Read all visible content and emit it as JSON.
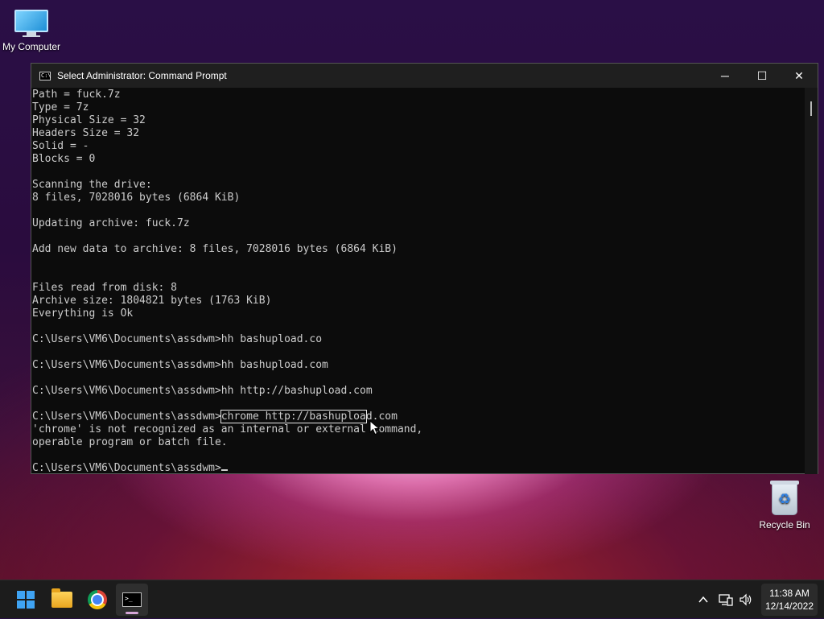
{
  "desktop": {
    "my_computer_label": "My Computer",
    "recycle_bin_label": "Recycle Bin"
  },
  "window": {
    "title": "Select Administrator: Command Prompt",
    "minimize_glyph": "─",
    "maximize_glyph": "☐",
    "close_glyph": "✕"
  },
  "console": {
    "lines": [
      "Path = fuck.7z",
      "Type = 7z",
      "Physical Size = 32",
      "Headers Size = 32",
      "Solid = -",
      "Blocks = 0",
      "",
      "Scanning the drive:",
      "8 files, 7028016 bytes (6864 KiB)",
      "",
      "Updating archive: fuck.7z",
      "",
      "Add new data to archive: 8 files, 7028016 bytes (6864 KiB)",
      "",
      "",
      "Files read from disk: 8",
      "Archive size: 1804821 bytes (1763 KiB)",
      "Everything is Ok",
      "",
      "C:\\Users\\VM6\\Documents\\assdwm>hh bashupload.co",
      "",
      "C:\\Users\\VM6\\Documents\\assdwm>hh bashupload.com",
      "",
      "C:\\Users\\VM6\\Documents\\assdwm>hh http://bashupload.com",
      ""
    ],
    "selected_prompt": "C:\\Users\\VM6\\Documents\\assdwm>",
    "selected_text": "chrome http://bashuploa",
    "selected_rest": "d.com",
    "error_lines": [
      "'chrome' is not recognized as an internal or external command,",
      "operable program or batch file.",
      ""
    ],
    "current_prompt": "C:\\Users\\VM6\\Documents\\assdwm>"
  },
  "taskbar": {
    "tray_chevron": "^",
    "clock_time": "11:38 AM",
    "clock_date": "12/14/2022"
  }
}
